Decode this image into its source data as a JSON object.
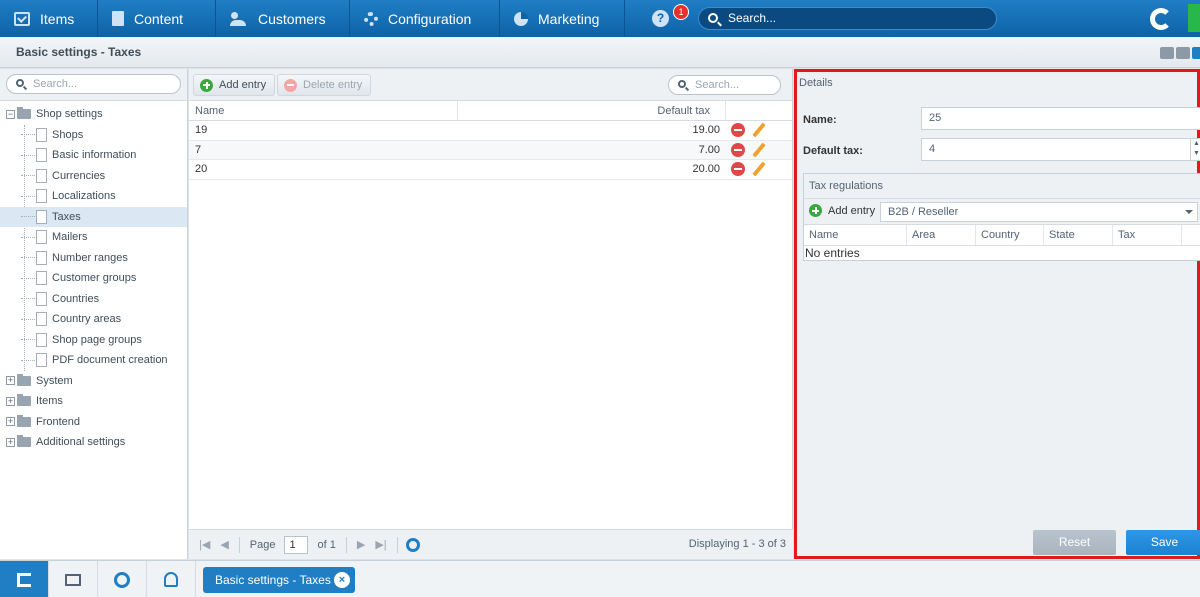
{
  "topnav": {
    "items": [
      {
        "label": "Items",
        "icon": "items-icon"
      },
      {
        "label": "Content",
        "icon": "content-icon"
      },
      {
        "label": "Customers",
        "icon": "customers-icon"
      },
      {
        "label": "Configuration",
        "icon": "gear-icon"
      },
      {
        "label": "Marketing",
        "icon": "pie-chart-icon"
      }
    ],
    "help_label": "?",
    "notification_count": "1",
    "search_placeholder": "Search..."
  },
  "window": {
    "title": "Basic settings - Taxes"
  },
  "tree": {
    "search_placeholder": "Search...",
    "root": {
      "label": "Shop settings",
      "expander": "−"
    },
    "children": [
      "Shops",
      "Basic information",
      "Currencies",
      "Localizations",
      "Taxes",
      "Mailers",
      "Number ranges",
      "Customer groups",
      "Countries",
      "Country areas",
      "Shop page groups",
      "PDF document creation"
    ],
    "selected": "Taxes",
    "collapsed": [
      {
        "label": "System",
        "expander": "+"
      },
      {
        "label": "Items",
        "expander": "+"
      },
      {
        "label": "Frontend",
        "expander": "+"
      },
      {
        "label": "Additional settings",
        "expander": "+"
      }
    ]
  },
  "grid": {
    "add_label": "Add entry",
    "delete_label": "Delete entry",
    "search_placeholder": "Search...",
    "columns": [
      "Name",
      "Default tax"
    ],
    "rows": [
      {
        "name": "19",
        "tax": "19.00"
      },
      {
        "name": "7",
        "tax": "7.00"
      },
      {
        "name": "20",
        "tax": "20.00"
      }
    ],
    "pager": {
      "first": "|◀",
      "prev": "◀",
      "page_label": "Page",
      "page_value": "1",
      "of_label": "of 1",
      "next": "▶",
      "last": "▶|",
      "display": "Displaying 1 - 3 of 3"
    }
  },
  "details": {
    "title": "Details",
    "name_label": "Name:",
    "name_value": "25",
    "tax_label": "Default tax:",
    "tax_value": "4",
    "spin_up": "▲",
    "spin_down": "▼",
    "tax_regulations": {
      "title": "Tax regulations",
      "add_label": "Add entry",
      "group_value": "B2B / Reseller",
      "columns": [
        "Name",
        "Area",
        "Country",
        "State",
        "Tax"
      ],
      "empty_text": "No entries"
    },
    "reset_label": "Reset",
    "save_label": "Save"
  },
  "taskbar": {
    "open_window": "Basic settings - Taxes",
    "close_symbol": "×"
  },
  "colors": {
    "brand_blue": "#1f7ec4",
    "highlight_border": "#e0191f",
    "badge_red": "#e3312e",
    "add_green": "#3aa73f"
  }
}
